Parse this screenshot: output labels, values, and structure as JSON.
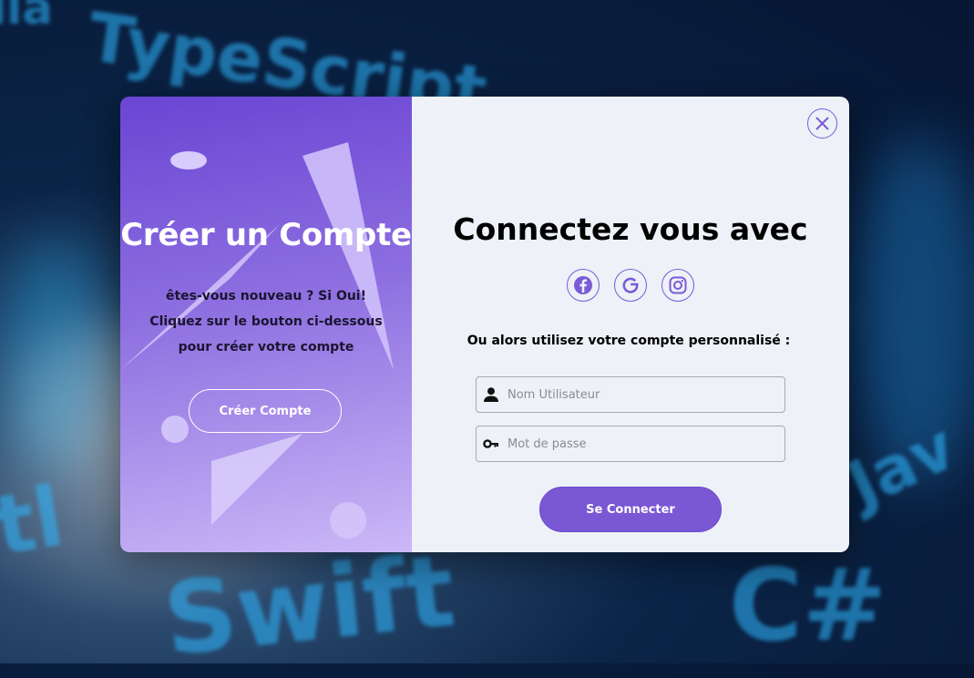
{
  "left_panel": {
    "title": "Créer un Compte",
    "description": "êtes-vous nouveau ? Si Oui! Cliquez sur le bouton ci-dessous pour créer votre compte",
    "create_button_label": "Créer Compte"
  },
  "right_panel": {
    "title": "Connectez vous avec",
    "social_icons": [
      "facebook-icon",
      "google-icon",
      "instagram-icon"
    ],
    "alt_text": "Ou alors utilisez votre compte personnalisé :",
    "username_placeholder": "Nom Utilisateur",
    "password_placeholder": "Mot de passe",
    "login_button_label": "Se Connecter"
  },
  "colors": {
    "accent": "#7a58d4",
    "left_gradient_start": "#6a45d4",
    "left_gradient_end": "#cbb8f7",
    "right_background": "#eef1f7"
  }
}
